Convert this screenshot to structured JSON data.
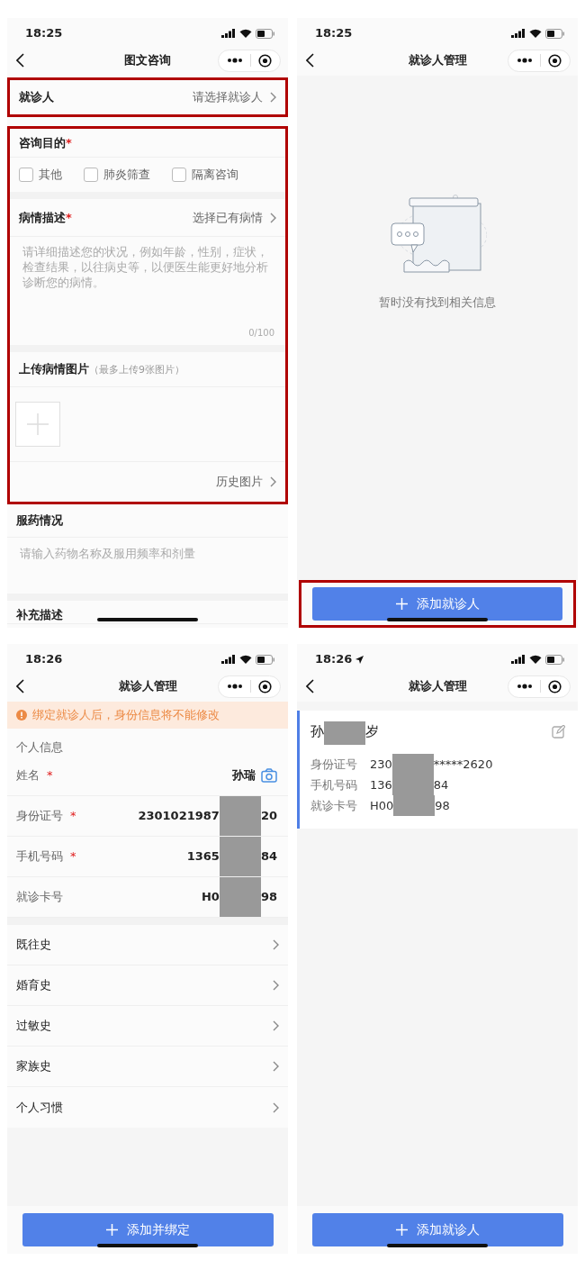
{
  "screens": [
    {
      "kind": "consult_form",
      "status_bar": {
        "time": "18:25"
      },
      "title": "图文咨询",
      "patient": {
        "label": "就诊人",
        "value": "请选择就诊人",
        "highlighted": true
      },
      "form_highlighted": true,
      "purpose": {
        "label": "咨询目的",
        "mark": "*",
        "options": [
          {
            "label": "其他",
            "checked": false
          },
          {
            "label": "肺炎筛查",
            "checked": false
          },
          {
            "label": "隔离咨询",
            "checked": false
          }
        ]
      },
      "description": {
        "label": "病情描述",
        "mark": "*",
        "link": "选择已有病情",
        "placeholder": "请详细描述您的状况，例如年龄，性别，症状，检查结果，以往病史等，以便医生能更好地分析诊断您的病情。",
        "counter": "0/100"
      },
      "upload": {
        "label": "上传病情图片",
        "hint": "（最多上传9张图片）",
        "history": "历史图片"
      },
      "medication": {
        "label": "服药情况",
        "placeholder": "请输入药物名称及服用频率和剂量"
      },
      "supplement": {
        "label": "补充描述"
      }
    },
    {
      "kind": "empty_list",
      "status_bar": {
        "time": "18:25"
      },
      "title": "就诊人管理",
      "empty_text": "暂时没有找到相关信息",
      "button": {
        "label": "添加就诊人",
        "highlighted": true
      }
    },
    {
      "kind": "patient_form",
      "status_bar": {
        "time": "18:26"
      },
      "title": "就诊人管理",
      "notice": "绑定就诊人后，身份信息将不能修改",
      "section": "个人信息",
      "fields": [
        {
          "label": "姓名",
          "mark": "*",
          "value": "孙瑞",
          "camera": true
        },
        {
          "label": "身份证号",
          "mark": "*",
          "value": "2301021987",
          "value_end": "20"
        },
        {
          "label": "手机号码",
          "mark": "*",
          "value": "1365",
          "value_end": "84"
        },
        {
          "label": "就诊卡号",
          "value": "H0",
          "value_end": "98"
        }
      ],
      "history": [
        "既往史",
        "婚育史",
        "过敏史",
        "家族史",
        "个人习惯"
      ],
      "button": {
        "label": "添加并绑定"
      }
    },
    {
      "kind": "patient_list",
      "status_bar": {
        "time": "18:26",
        "location": true
      },
      "title": "就诊人管理",
      "patients": [
        {
          "name": "孙",
          "name_end": "岁",
          "fields": [
            {
              "label": "身份证号",
              "value": "230",
              "value_end": "*****2620"
            },
            {
              "label": "手机号码",
              "value": "136",
              "value_end": "84"
            },
            {
              "label": "就诊卡号",
              "value": "H00",
              "value_end": "98"
            }
          ]
        }
      ],
      "button": {
        "label": "添加就诊人"
      }
    }
  ]
}
